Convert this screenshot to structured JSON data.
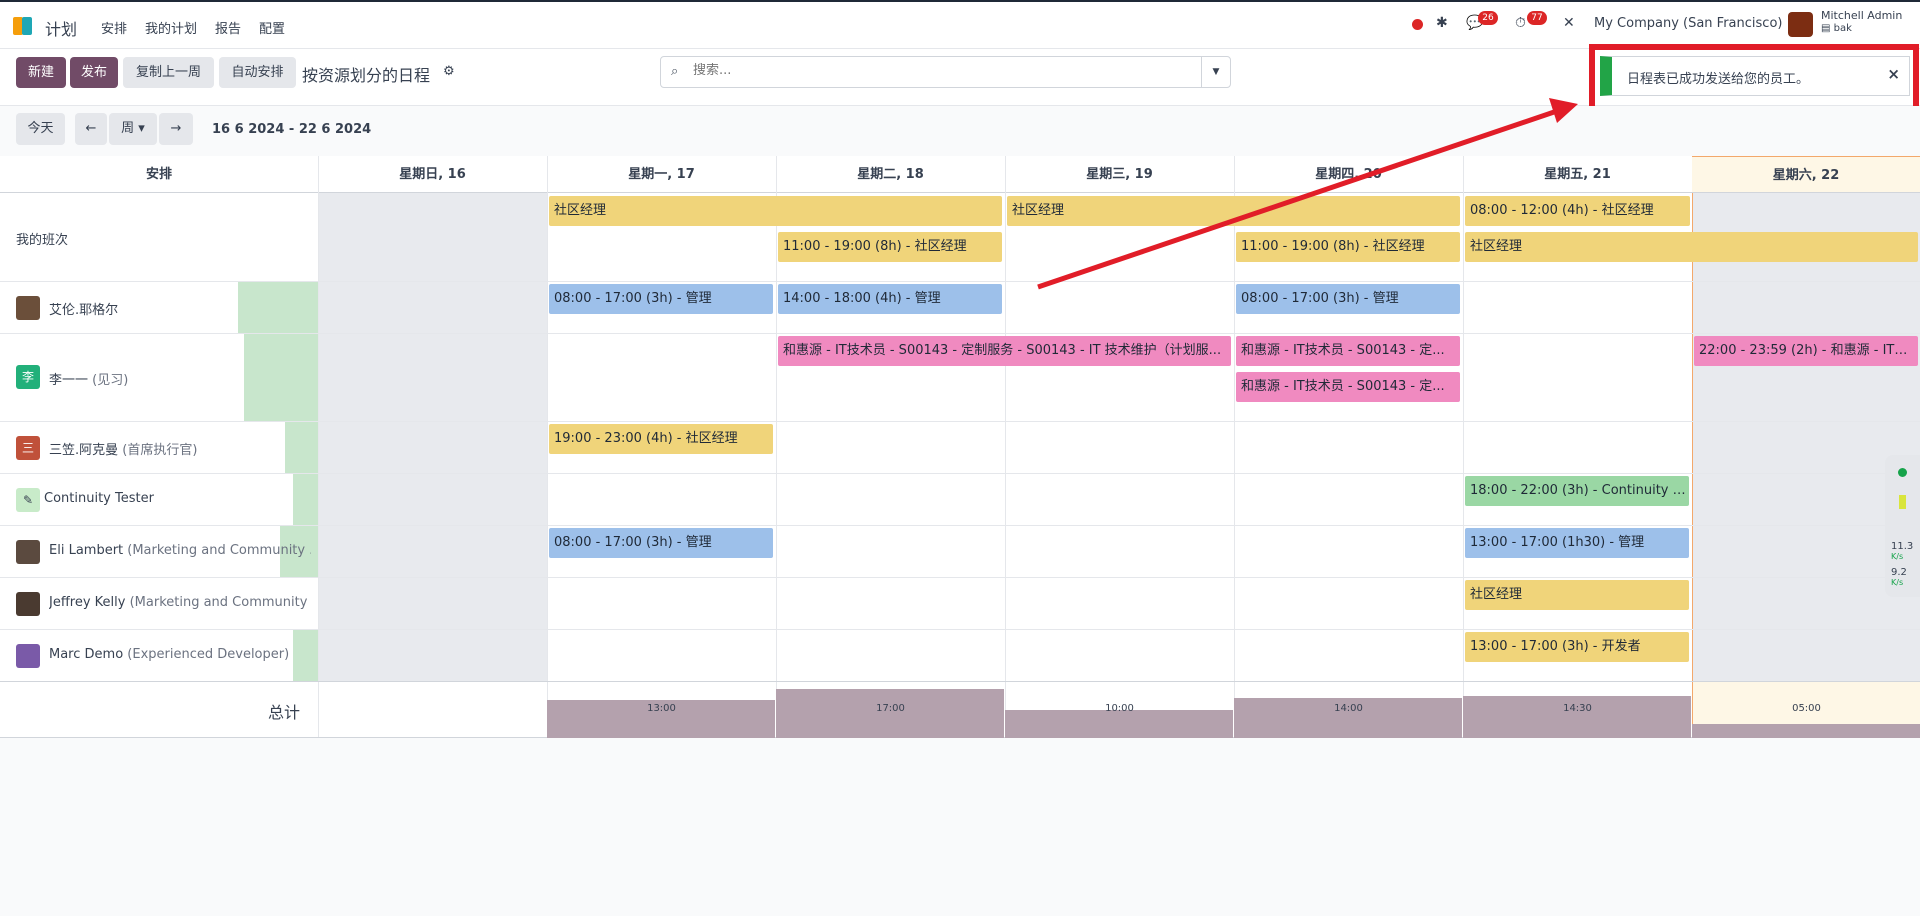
{
  "app": {
    "name": "计划",
    "menu": [
      "安排",
      "我的计划",
      "报告",
      "配置"
    ]
  },
  "system": {
    "chat_badge": "26",
    "activity_badge": "77",
    "company": "My Company (San Francisco)",
    "user_name": "Mitchell Admin",
    "user_db": "bak"
  },
  "control": {
    "new_label": "新建",
    "publish_label": "发布",
    "copy_week_label": "复制上一周",
    "auto_plan_label": "自动安排",
    "title": "按资源划分的日程",
    "search_placeholder": "搜索..."
  },
  "toast": {
    "message": "日程表已成功发送给您的员工。"
  },
  "nav": {
    "today": "今天",
    "scale": "周",
    "range": "16 6 2024 - 22 6 2024"
  },
  "grid": {
    "row_header": "安排",
    "days": [
      "星期日, 16",
      "星期一, 17",
      "星期二, 18",
      "星期三, 19",
      "星期四, 20",
      "星期五, 21",
      "星期六, 22"
    ],
    "rows": [
      {
        "name": "我的班次",
        "sub": ""
      },
      {
        "name": "艾伦.耶格尔",
        "sub": ""
      },
      {
        "name": "李一一",
        "sub": " (见习)",
        "initial": "李"
      },
      {
        "name": "三笠.阿克曼",
        "sub": " (首席执行官)",
        "initial": "三"
      },
      {
        "name": "Continuity Tester",
        "sub": ""
      },
      {
        "name": "Eli Lambert",
        "sub": " (Marketing and Community ..."
      },
      {
        "name": "Jeffrey Kelly",
        "sub": " (Marketing and Community ..."
      },
      {
        "name": "Marc Demo",
        "sub": " (Experienced Developer)"
      }
    ],
    "shifts": {
      "s1": "社区经理",
      "s2": "社区经理",
      "s3": "08:00 - 12:00 (4h) - 社区经理",
      "s4": "11:00 - 19:00 (8h) - 社区经理",
      "s5": "11:00 - 19:00 (8h) - 社区经理",
      "s6": "社区经理",
      "s7": "08:00 - 17:00 (3h) - 管理",
      "s8": "14:00 - 18:00 (4h) - 管理",
      "s9": "08:00 - 17:00 (3h) - 管理",
      "s10": "和惠源 - IT技术员 - S00143 - 定制服务 - S00143 - IT 技术维护（计划服...",
      "s11": "和惠源 - IT技术员 - S00143 - 定...",
      "s12": "和惠源 - IT技术员 - S00143 - 定...",
      "s13": "22:00 - 23:59 (2h) - 和惠源 - IT技...",
      "s14": "19:00 - 23:00 (4h) - 社区经理",
      "s15": "18:00 - 22:00 (3h) - Continuity Te...",
      "s16": "08:00 - 17:00 (3h) - 管理",
      "s17": "13:00 - 17:00 (1h30) - 管理",
      "s18": "社区经理",
      "s19": "13:00 - 17:00 (3h) - 开发者"
    },
    "total_label": "总计",
    "totals": [
      "13:00",
      "17:00",
      "10:00",
      "14:00",
      "14:30",
      "05:00"
    ],
    "total_levels": [
      0.76,
      0.98,
      0.56,
      0.8,
      0.84,
      0.28
    ]
  },
  "side_widget": {
    "up": "11.3",
    "up_unit": "K/s",
    "down": "9.2",
    "down_unit": "K/s"
  },
  "colors": {
    "primary": "#714b67",
    "annotation": "#e11d28",
    "success": "#22a447"
  }
}
